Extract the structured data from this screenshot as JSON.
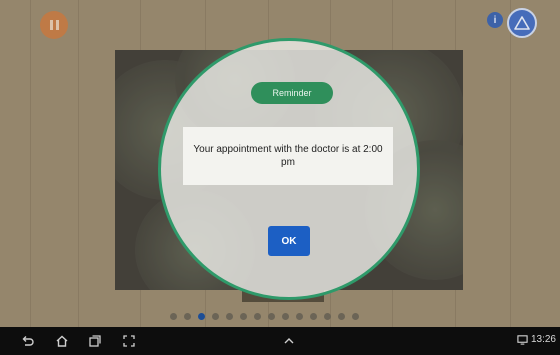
{
  "dialog": {
    "title": "Reminder",
    "message": "Your appointment with the doctor is at 2:00 pm",
    "ok_label": "OK"
  },
  "top_controls": {
    "info_badge": "i"
  },
  "pager": {
    "count": 14,
    "active_index": 2
  },
  "status_bar": {
    "time": "13:26"
  },
  "colors": {
    "accent_green": "#2f8f5b",
    "ok_blue": "#1c5fc4",
    "pause_orange": "#c76a28",
    "alert_blue": "#2a5bbd"
  },
  "icons": [
    "pause-icon",
    "info-icon",
    "alert-triangle-icon",
    "back-icon",
    "home-icon",
    "recent-apps-icon",
    "screenshot-icon",
    "chevron-up-icon",
    "screen-icon"
  ]
}
